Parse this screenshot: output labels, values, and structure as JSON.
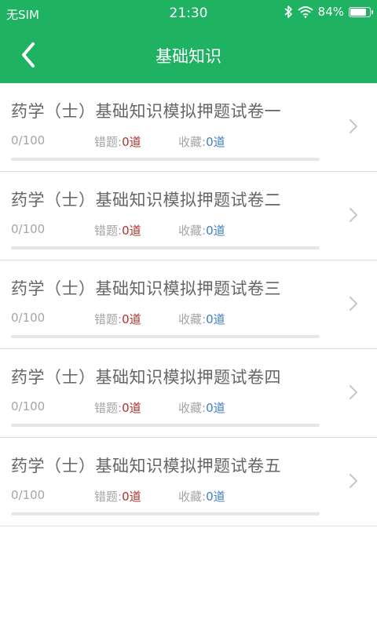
{
  "status_bar": {
    "carrier": "无SIM",
    "time": "21:30",
    "battery": "84%",
    "battery_level": 0.84,
    "icons": [
      "bluetooth-icon",
      "wifi-icon",
      "battery-icon"
    ]
  },
  "header": {
    "title": "基础知识",
    "back_icon": "chevron-left-icon"
  },
  "colors": {
    "brand": "#1fb263",
    "wrong_value": "#b0312d",
    "fav_value": "#3d7fc6"
  },
  "papers": [
    {
      "title": "药学（士）基础知识模拟押题试卷一",
      "progress": "0/100",
      "progress_fraction": 0,
      "wrong_label": "错题:",
      "wrong_value": "0道",
      "fav_label": "收藏:",
      "fav_value": "0道"
    },
    {
      "title": "药学（士）基础知识模拟押题试卷二",
      "progress": "0/100",
      "progress_fraction": 0,
      "wrong_label": "错题:",
      "wrong_value": "0道",
      "fav_label": "收藏:",
      "fav_value": "0道"
    },
    {
      "title": "药学（士）基础知识模拟押题试卷三",
      "progress": "0/100",
      "progress_fraction": 0,
      "wrong_label": "错题:",
      "wrong_value": "0道",
      "fav_label": "收藏:",
      "fav_value": "0道"
    },
    {
      "title": "药学（士）基础知识模拟押题试卷四",
      "progress": "0/100",
      "progress_fraction": 0,
      "wrong_label": "错题:",
      "wrong_value": "0道",
      "fav_label": "收藏:",
      "fav_value": "0道"
    },
    {
      "title": "药学（士）基础知识模拟押题试卷五",
      "progress": "0/100",
      "progress_fraction": 0,
      "wrong_label": "错题:",
      "wrong_value": "0道",
      "fav_label": "收藏:",
      "fav_value": "0道"
    }
  ]
}
